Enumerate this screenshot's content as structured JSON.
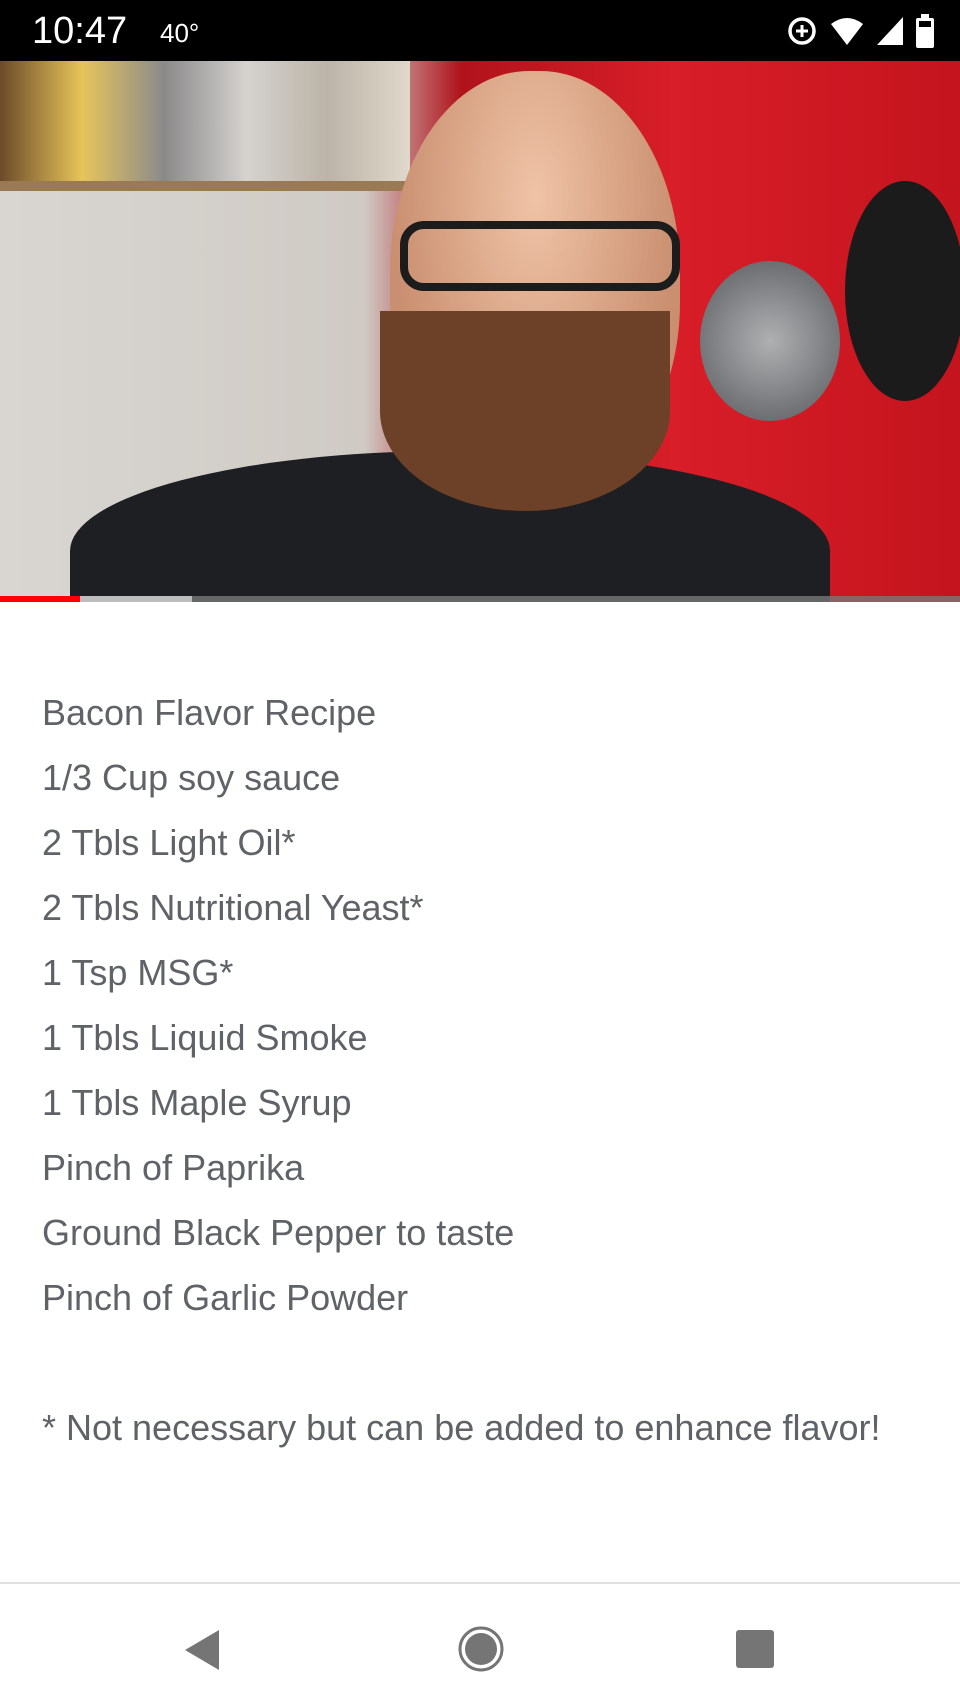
{
  "status_bar": {
    "time": "10:47",
    "temperature": "40°",
    "icons": [
      "data-saver-icon",
      "wifi-icon",
      "signal-icon",
      "battery-icon"
    ]
  },
  "video": {
    "played_fraction": 0.083,
    "buffered_fraction": 0.2,
    "progress_color": "#ff0000"
  },
  "description": {
    "lines": [
      "Bacon Flavor Recipe",
      "1/3 Cup soy sauce",
      "2 Tbls Light Oil*",
      "2 Tbls Nutritional Yeast*",
      "1 Tsp MSG*",
      "1 Tbls Liquid Smoke",
      "1 Tbls Maple Syrup",
      "Pinch of Paprika",
      "Ground Black Pepper to taste",
      "Pinch of Garlic Powder"
    ],
    "footnote": "* Not necessary but can be added to enhance flavor!"
  },
  "nav_bar": {
    "buttons": [
      "back",
      "home",
      "recents"
    ]
  }
}
